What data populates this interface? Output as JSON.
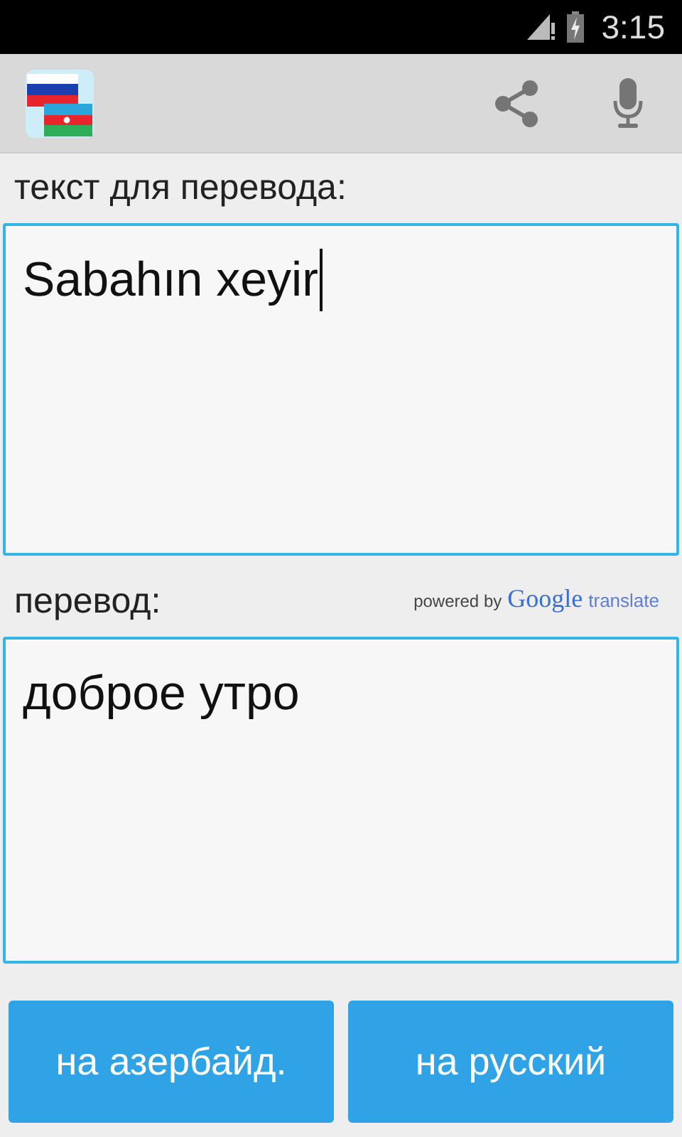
{
  "status_bar": {
    "time": "3:15"
  },
  "source": {
    "label": "текст для перевода:",
    "value": "Sabahın xeyir"
  },
  "result": {
    "label": "перевод:",
    "powered_by": "powered by",
    "brand": "Google",
    "brand_suffix": "translate",
    "value": "доброе утро"
  },
  "buttons": [
    {
      "label": "на азербайд."
    },
    {
      "label": "на русский"
    }
  ]
}
